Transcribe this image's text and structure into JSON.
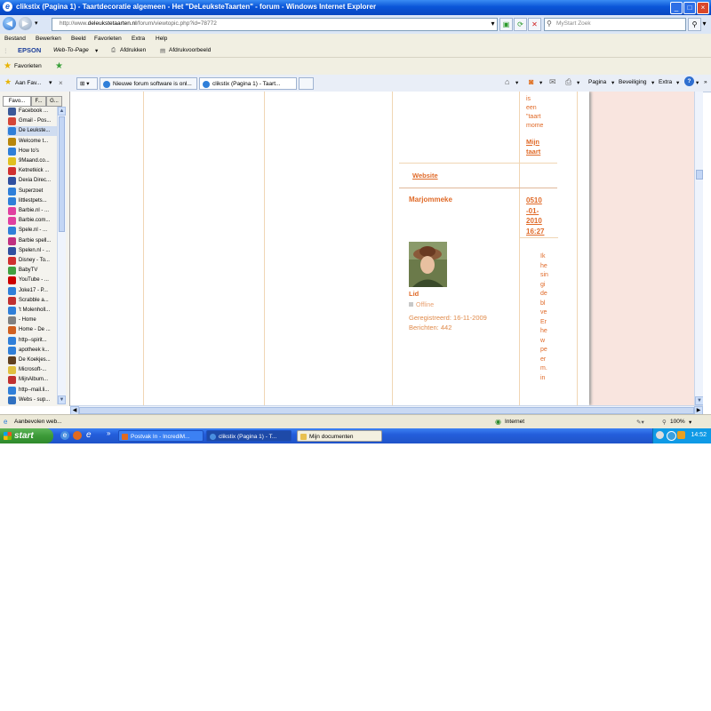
{
  "window": {
    "title": "clikstix (Pagina 1) - Taartdecoratie algemeen - Het \"DeLeuksteTaarten\" - forum - Windows Internet Explorer",
    "min": "_",
    "max": "□",
    "close": "×"
  },
  "address": {
    "prefix": "http://www.",
    "host": "deleukstetaarten.nl",
    "path": "/forum/viewtopic.php?id=78772",
    "search_placeholder": "MyStart Zoek"
  },
  "menu": [
    "Bestand",
    "Bewerken",
    "Beeld",
    "Favorieten",
    "Extra",
    "Help"
  ],
  "epson": {
    "brand": "EPSON",
    "web_to_page": "Web-To-Page",
    "print": "Afdrukken",
    "preview": "Afdrukvoorbeeld"
  },
  "favbar": {
    "label": "Favorieten"
  },
  "panel": {
    "header": "Aan Fav...",
    "tabs": [
      "Favo...",
      "F...",
      "G..."
    ],
    "items": [
      "Facebook ...",
      "Gmail - Pos...",
      "De Leukste...",
      "Welcome t...",
      "How to's",
      "9Maand.co...",
      "Ketnetkick ...",
      "Dexia Direc...",
      "Superzoet",
      "littlestpets...",
      "Barbie.nl - ...",
      "Barbie.com...",
      "Spele.nl - ...",
      "Barbie spell...",
      "Spelen.nl - ...",
      "Disney - To...",
      "BabyTV",
      "YouTube - ...",
      "Joke17 - P...",
      "Scrabble a...",
      "'t Molenholl...",
      "- Home",
      "Home - De ...",
      "http--spirit...",
      "apotheek k...",
      "De Koekjes...",
      "Microsoft-...",
      "MijnAlbum...",
      "http--mail.li...",
      "Webs - sup..."
    ],
    "item_colors": [
      "#3b5998",
      "#d44638",
      "#2f7fd9",
      "#b8860b",
      "#2f7fd9",
      "#e0c020",
      "#d03030",
      "#3050a0",
      "#2f7fd9",
      "#2f7fd9",
      "#e040a0",
      "#e040a0",
      "#2f7fd9",
      "#c03080",
      "#3050a0",
      "#d03030",
      "#40a040",
      "#cc0000",
      "#2f7fd9",
      "#c03030",
      "#2f7fd9",
      "#808080",
      "#d06020",
      "#2f7fd9",
      "#2f7fd9",
      "#604020",
      "#e0c040",
      "#c03030",
      "#2f7fd9",
      "#3070c0"
    ],
    "suggested": "Aanbevolen web..."
  },
  "tabs": [
    {
      "label": "Nieuwe forum software is onl..."
    },
    {
      "label": "clikstix (Pagina 1) - Taart..."
    }
  ],
  "commands": [
    "Pagina",
    "Beveiliging",
    "Extra"
  ],
  "post_top": {
    "text_lines": [
      "is",
      "een",
      "\"taart",
      "mome"
    ],
    "link_lines": [
      "Mijn",
      "taart"
    ],
    "website": "Website"
  },
  "post": {
    "author": "Marjommeke",
    "date_lines": [
      "0510",
      "-01-",
      "2010",
      "16:27"
    ],
    "role": "Lid",
    "status": "Offline",
    "registered": "Geregistreerd: 16-11-2009",
    "posts": "Berichten: 442",
    "message_lines": [
      "Ik",
      "he",
      "sin",
      "gi",
      "de",
      "bl",
      "ve",
      "Er",
      "he",
      "w",
      "pe",
      "er",
      "m.",
      "in"
    ]
  },
  "status": {
    "zone": "Internet",
    "zoom": "100%"
  },
  "taskbar": {
    "start": "start",
    "tasks": [
      "Postvak In - IncrediM...",
      "clikstix (Pagina 1) - T...",
      "Mijn documenten"
    ],
    "clock": "14:52"
  }
}
